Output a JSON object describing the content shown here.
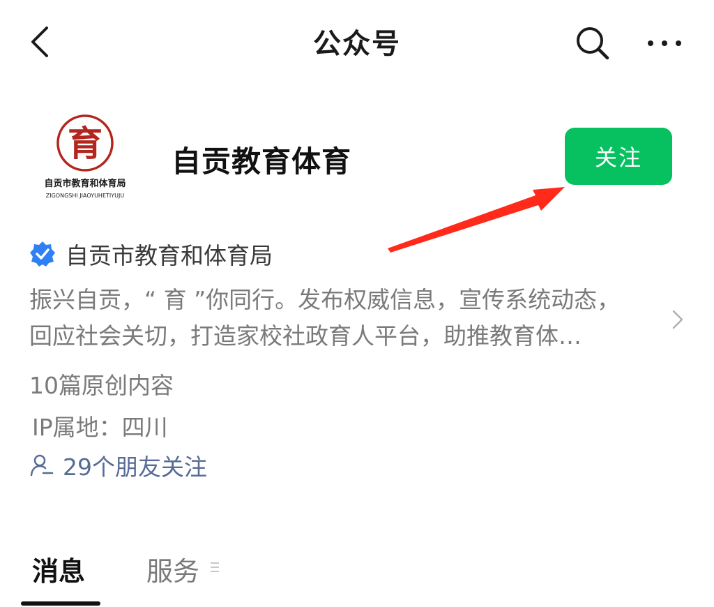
{
  "nav": {
    "title": "公众号",
    "back_icon": "chevron-left-icon",
    "search_icon": "search-icon",
    "more_icon": "more-horizontal-icon"
  },
  "account": {
    "name": "自贡教育体育",
    "logo": {
      "name_cn": "自贡市教育和体育局",
      "name_pinyin": "ZIGONGSHI JIAOYUHETIYUJU",
      "seal_char": "育"
    },
    "follow_label": "关注",
    "verified_org": "自贡市教育和体育局",
    "description_lines": [
      "振兴自贡，“ 育 ”你同行。发布权威信息，宣传系统动态，",
      "回应社会关切，打造家校社政育人平台，助推教育体…"
    ],
    "original_count": "10篇原创内容",
    "ip_location": "IP属地：四川",
    "friends_following": "29个朋友关注"
  },
  "tabs": [
    {
      "label": "消息",
      "active": true
    },
    {
      "label": "服务",
      "active": false
    }
  ],
  "colors": {
    "follow_button": "#07c160",
    "verified_badge": "#2f7ff5",
    "link_text": "#576b95",
    "logo_red": "#b3261e",
    "annotation_arrow": "#ff2a1a"
  }
}
